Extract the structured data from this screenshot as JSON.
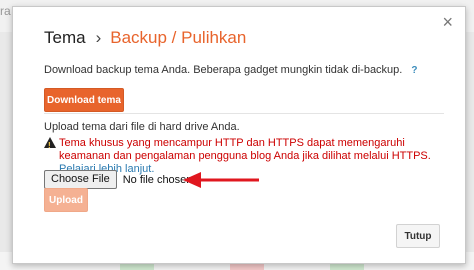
{
  "background": {
    "left_text": "ra"
  },
  "dialog": {
    "breadcrumb": {
      "parent": "Tema",
      "separator": "›",
      "current": "Backup / Pulihkan"
    },
    "close_glyph": "×",
    "download_section": {
      "description": "Download backup tema Anda. Beberapa gadget mungkin tidak di-backup.",
      "help": "?",
      "button_label": "Download tema"
    },
    "upload_section": {
      "description": "Upload tema dari file di hard drive Anda.",
      "warning_text": "Tema khusus yang mencampur HTTP dan HTTPS dapat memengaruhi keamanan dan pengalaman pengguna blog Anda jika dilihat melalui HTTPS.",
      "warning_link": "Pelajari lebih lanjut.",
      "file_button": "Choose File",
      "file_status": "No file chosen",
      "upload_button": "Upload"
    },
    "footer_button": "Tutup"
  },
  "colors": {
    "accent": "#e8642c",
    "warning": "#cc0000",
    "link": "#2a7ab0",
    "arrow": "#e0171f"
  },
  "icons": {
    "warning": "warning-triangle-icon",
    "close": "close-icon",
    "annotation": "red-arrow-icon"
  }
}
